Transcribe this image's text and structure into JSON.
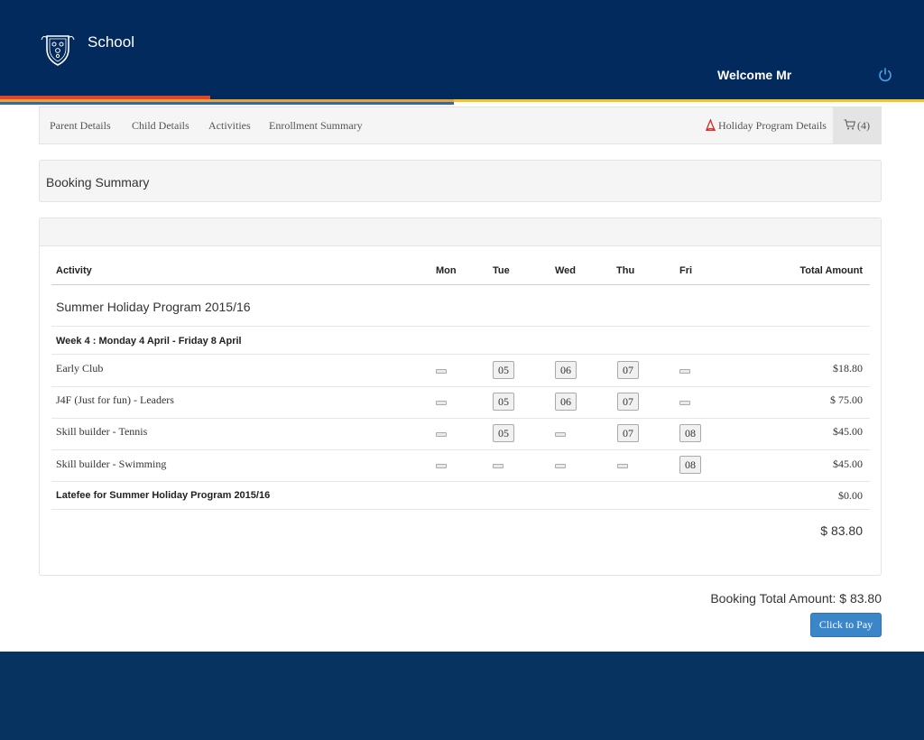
{
  "header": {
    "school_name": "School",
    "welcome": "Welcome Mr",
    "colors": {
      "navy": "#032a5c",
      "footer": "#06335f",
      "accent_blue": "#3a86c8"
    }
  },
  "nav": {
    "items": [
      "Parent Details",
      "Child Details",
      "Activities",
      "Enrollment Summary"
    ],
    "holiday_program": "Holiday Program Details",
    "cart_count": "(4)"
  },
  "page_title": "Booking Summary",
  "table": {
    "headers": {
      "activity": "Activity",
      "days": [
        "Mon",
        "Tue",
        "Wed",
        "Thu",
        "Fri"
      ],
      "total": "Total Amount"
    },
    "program": "Summer Holiday Program 2015/16",
    "week": "Week 4 : Monday 4 April - Friday 8 April",
    "rows": [
      {
        "name": "Early Club",
        "days": [
          "",
          "05",
          "06",
          "07",
          ""
        ],
        "amount": "$18.80"
      },
      {
        "name": "J4F (Just for fun) - Leaders",
        "days": [
          "",
          "05",
          "06",
          "07",
          ""
        ],
        "amount": "$  75.00"
      },
      {
        "name": "Skill builder - Tennis",
        "days": [
          "",
          "05",
          "",
          "07",
          "08"
        ],
        "amount": "$45.00"
      },
      {
        "name": "Skill builder - Swimming",
        "days": [
          "",
          "",
          "",
          "",
          "08"
        ],
        "amount": "$45.00"
      }
    ],
    "latefee_label": "Latefee for Summer Holiday Program 2015/16",
    "latefee_amount": "$0.00",
    "subtotal": "$  83.80"
  },
  "booking_total": "Booking Total Amount: $  83.80",
  "pay_button": "Click to Pay"
}
